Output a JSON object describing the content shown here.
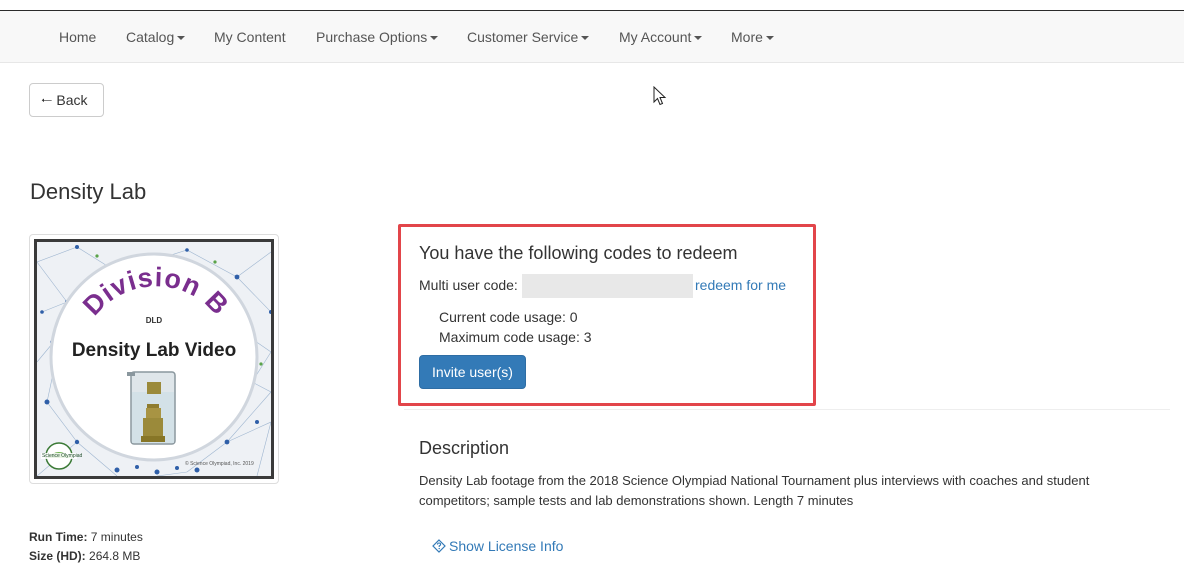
{
  "nav": {
    "items": [
      {
        "label": "Home",
        "dropdown": false
      },
      {
        "label": "Catalog",
        "dropdown": true
      },
      {
        "label": "My Content",
        "dropdown": false
      },
      {
        "label": "Purchase Options",
        "dropdown": true
      },
      {
        "label": "Customer Service",
        "dropdown": true
      },
      {
        "label": "My Account",
        "dropdown": true
      },
      {
        "label": "More",
        "dropdown": true
      }
    ]
  },
  "back_button": {
    "label": "Back",
    "icon": "arrow-left-icon"
  },
  "product": {
    "title": "Density Lab",
    "thumbnail": {
      "heading": "Division B",
      "code": "DLD",
      "caption": "Density Lab Video",
      "logo_text": "Science Olympiad",
      "copyright": "© Science Olympiad, Inc. 2019"
    },
    "run_time_label": "Run Time:",
    "run_time_value": "7 minutes",
    "size_label": "Size (HD):",
    "size_value": "264.8 MB"
  },
  "codes": {
    "title": "You have the following codes to redeem",
    "multi_user_label": "Multi user code:",
    "multi_user_value": "",
    "redeem_link": "redeem for me",
    "current_usage": "Current code usage: 0",
    "maximum_usage": "Maximum code usage: 3",
    "invite_button": "Invite user(s)",
    "highlight_color": "#e2454a"
  },
  "description": {
    "heading": "Description",
    "text": "Density Lab footage from the 2018 Science Olympiad National Tournament plus interviews with coaches and student competitors; sample tests and lab demonstrations shown. Length 7 minutes"
  },
  "license": {
    "label": "Show License Info",
    "icon": "question-diamond-icon"
  },
  "colors": {
    "link": "#337ab7",
    "primary_button": "#337ab7",
    "navbar_bg": "#f8f8f8"
  }
}
